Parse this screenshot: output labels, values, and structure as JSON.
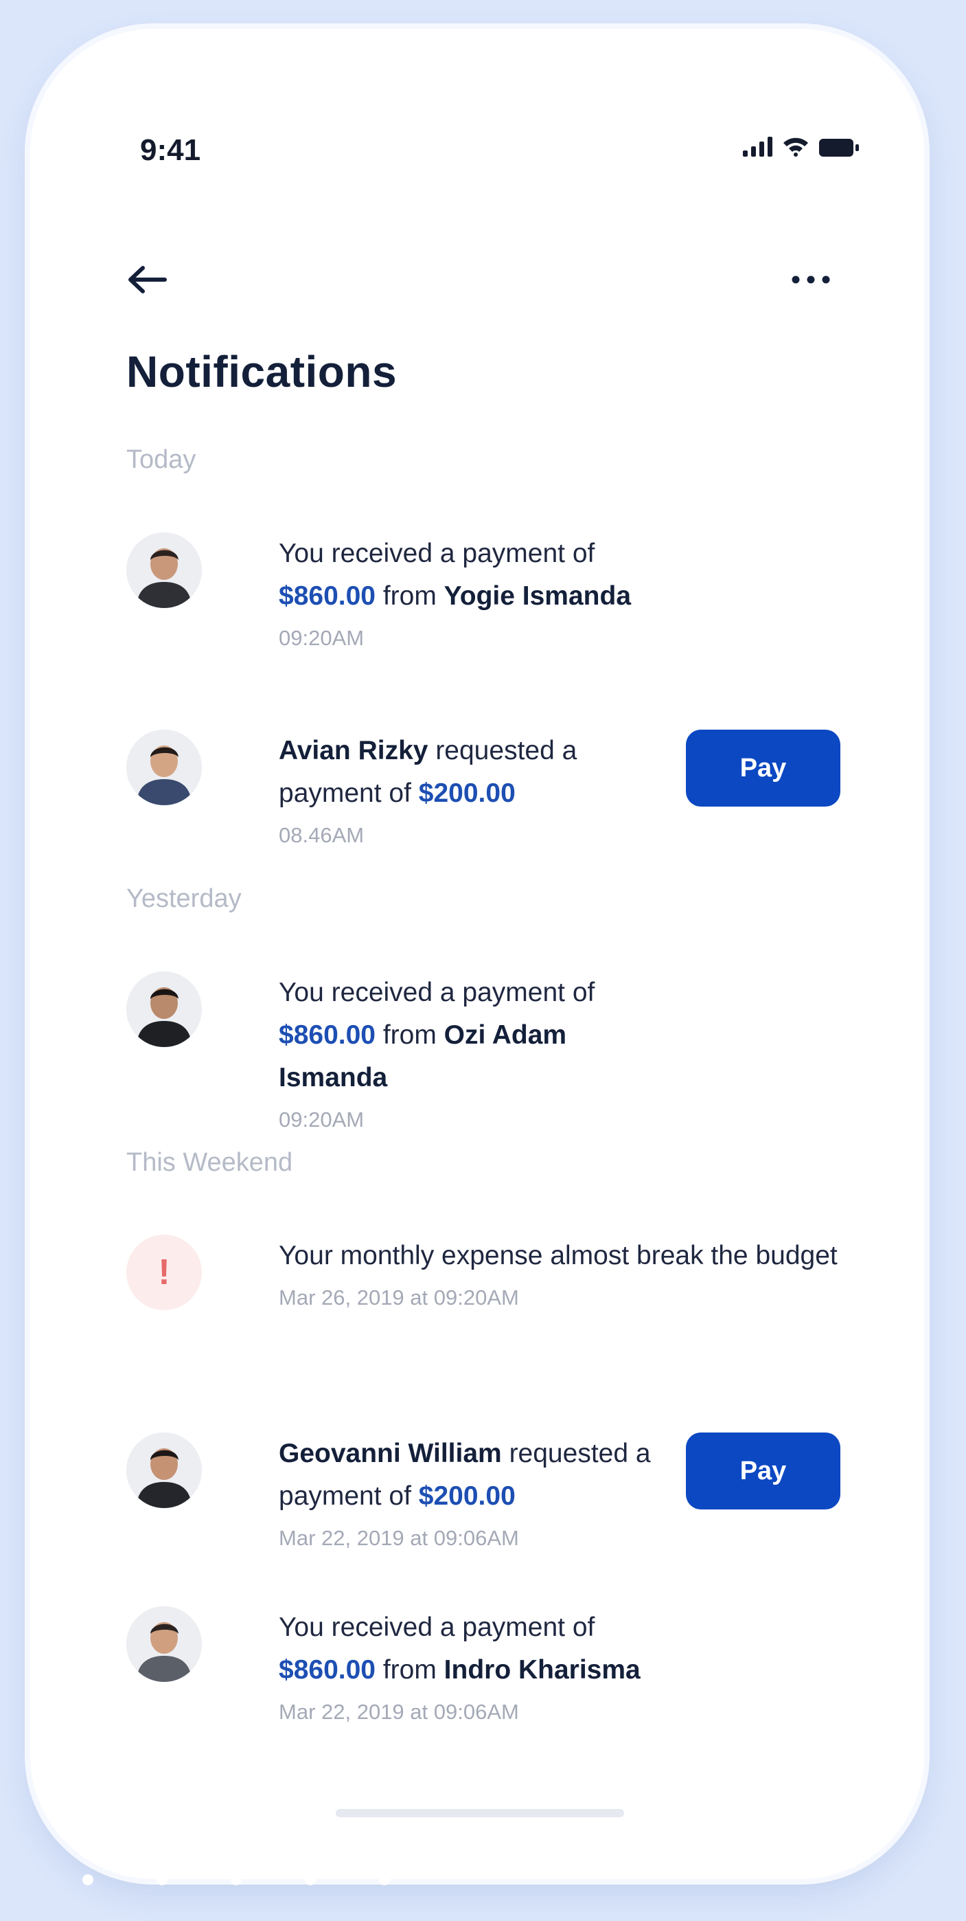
{
  "status_bar": {
    "time": "9:41"
  },
  "nav": {
    "back_icon": "arrow-left-icon",
    "more_icon": "more-horizontal-icon"
  },
  "page": {
    "title": "Notifications"
  },
  "colors": {
    "accent": "#0c48c2",
    "amount": "#1d4fb3",
    "title": "#14203a",
    "muted": "#a4a9b6",
    "alert": "#e66a6a",
    "background": "#dbe6fb"
  },
  "sections": {
    "today": "Today",
    "yesterday": "Yesterday",
    "weekend": "This Weekend"
  },
  "notifications": [
    {
      "prefix": "You received a payment of ",
      "amount": "$860.00",
      "mid": " from ",
      "name": "Yogie Ismanda",
      "time": "09:20AM"
    },
    {
      "name": "Avian Rizky",
      "mid": " requested a payment of ",
      "amount": "$200.00",
      "time": "08.46AM",
      "action": "Pay"
    },
    {
      "prefix": "You received a payment of ",
      "amount": "$860.00",
      "mid": " from ",
      "name": "Ozi Adam Ismanda",
      "time": "09:20AM"
    },
    {
      "text": "Your monthly expense almost break the budget",
      "time": "Mar 26, 2019 at 09:20AM",
      "icon": "alert-icon",
      "glyph": "!"
    },
    {
      "name": "Geovanni William",
      "mid": " requested a payment of ",
      "amount": "$200.00",
      "time": "Mar 22, 2019 at 09:06AM",
      "action": "Pay"
    },
    {
      "prefix": "You received a payment of ",
      "amount": "$860.00",
      "mid": " from ",
      "name": "Indro Kharisma",
      "time": "Mar 22, 2019 at 09:06AM"
    }
  ]
}
